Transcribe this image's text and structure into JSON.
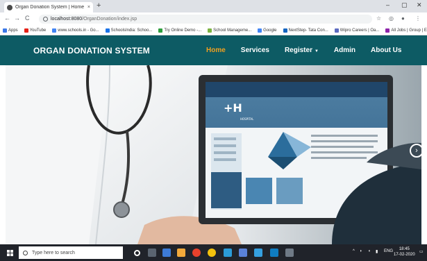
{
  "browser": {
    "tab_title": "Organ Donation System | Home",
    "tab_close": "×",
    "new_tab": "+",
    "window_controls": {
      "minimize": "–",
      "maximize": "▢",
      "close": "✕"
    },
    "nav": {
      "back": "←",
      "forward": "→",
      "reload": "C"
    },
    "url_host": "localhost:8080",
    "url_path": "/OrganDonation/index.jsp",
    "bookmarks": [
      {
        "label": "Apps",
        "color": "#3b78e7"
      },
      {
        "label": "YouTube",
        "color": "#e62117"
      },
      {
        "label": "www.schools.in - Go...",
        "color": "#4285f4"
      },
      {
        "label": "SchoolsIndia: Schoo...",
        "color": "#1a73e8"
      },
      {
        "label": "Try Online Demo -...",
        "color": "#2e9e3e"
      },
      {
        "label": "School Manageme...",
        "color": "#7cb342"
      },
      {
        "label": "Google",
        "color": "#4285f4"
      },
      {
        "label": "NextStep- Tata Con...",
        "color": "#1565c0"
      },
      {
        "label": "Wipro Careers | Oa...",
        "color": "#5c6bc0"
      },
      {
        "label": "All Jobs | Group | E...",
        "color": "#8e24aa"
      }
    ]
  },
  "site": {
    "brand": "ORGAN DONATION SYSTEM",
    "menu": [
      {
        "label": "Home",
        "active": true
      },
      {
        "label": "Services",
        "active": false
      },
      {
        "label": "Register",
        "active": false,
        "dropdown": true
      },
      {
        "label": "Admin",
        "active": false
      },
      {
        "label": "About Us",
        "active": false
      }
    ],
    "hero": {
      "screen_logo_text": "+H",
      "screen_logo_sub": "HOSPITAL",
      "next_arrow": "›"
    },
    "colors": {
      "nav_bg": "#0d5b64",
      "active": "#f0a020"
    }
  },
  "taskbar": {
    "search_placeholder": "Type here to search",
    "tray_lang": "ENG",
    "time": "18:45",
    "date": "17-02-2020"
  }
}
